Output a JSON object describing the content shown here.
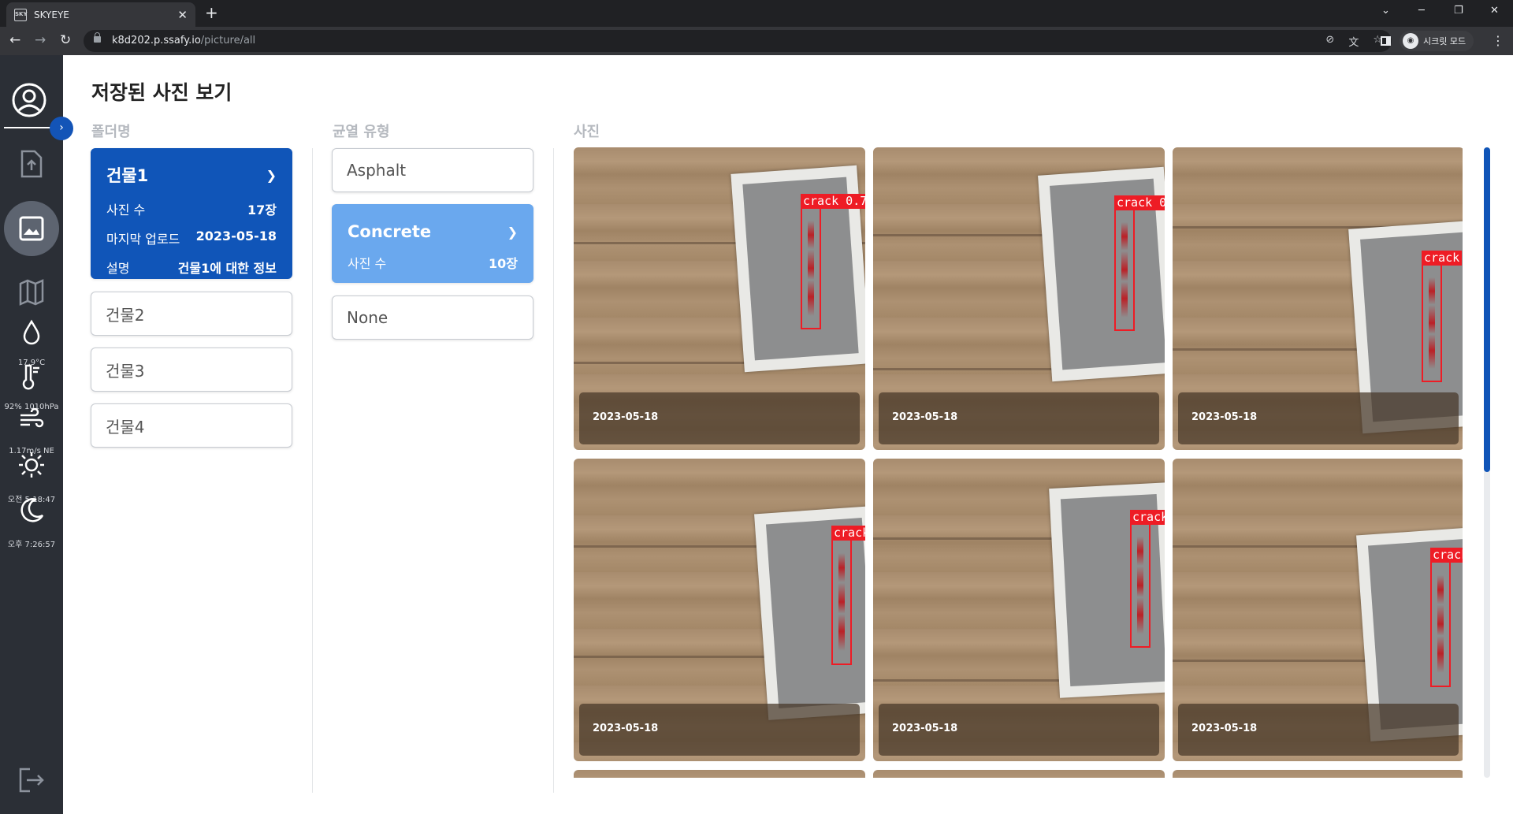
{
  "browser": {
    "tab_title": "SKYEYE",
    "tab_favicon": "SKY",
    "new_tab": "+",
    "url_host": "k8d202.p.ssafy.io",
    "url_path": "/picture/all",
    "incognito_label": "시크릿 모드"
  },
  "sidebar": {
    "expand_icon": "›",
    "weather": {
      "temperature": "17.9°C",
      "humidity_pressure": "92% 1010hPa",
      "wind": "1.17m/s NE",
      "sunrise": "오전 5:18:47",
      "sunset": "오후 7:26:57"
    }
  },
  "page": {
    "title": "저장된 사진 보기"
  },
  "folders": {
    "label": "폴더명",
    "selected": {
      "name": "건물1",
      "photo_count_label": "사진 수",
      "photo_count": "17장",
      "last_upload_label": "마지막 업로드",
      "last_upload": "2023-05-18",
      "desc_label": "설명",
      "desc": "건물1에 대한 정보"
    },
    "others": [
      "건물2",
      "건물3",
      "건물4"
    ]
  },
  "crack_types": {
    "label": "균열 유형",
    "items": [
      "Asphalt",
      "Concrete",
      "None"
    ],
    "selected": {
      "name": "Concrete",
      "photo_count_label": "사진 수",
      "photo_count": "10장"
    }
  },
  "photos": {
    "label": "사진",
    "items": [
      {
        "date": "2023-05-18",
        "detection": "crack 0.7"
      },
      {
        "date": "2023-05-18",
        "detection": "crack 0"
      },
      {
        "date": "2023-05-18",
        "detection": "crack"
      },
      {
        "date": "2023-05-18",
        "detection": "crack"
      },
      {
        "date": "2023-05-18",
        "detection": "crack"
      },
      {
        "date": "2023-05-18",
        "detection": "crack"
      }
    ]
  },
  "colors": {
    "primary": "#1055b8",
    "primary_light": "#6aa8ee",
    "sidebar_bg": "#2b2f36",
    "detection_red": "#ee1c25"
  }
}
